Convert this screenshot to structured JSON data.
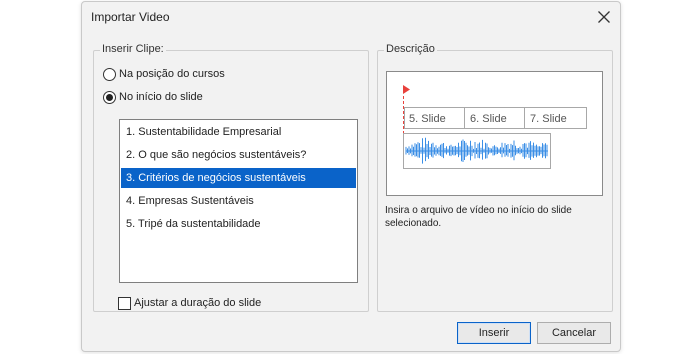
{
  "dialog": {
    "title": "Importar Video",
    "close_icon": "close-icon"
  },
  "insert_clip": {
    "legend": "Inserir Clipe:",
    "options": [
      {
        "label": "Na posição do cursos",
        "checked": false
      },
      {
        "label": "No início do slide",
        "checked": true
      }
    ],
    "slides": [
      {
        "label": "1. Sustentabilidade Empresarial",
        "selected": false
      },
      {
        "label": "2. O que são negócios sustentáveis?",
        "selected": false
      },
      {
        "label": "3. Critérios de negócios sustentáveis",
        "selected": true
      },
      {
        "label": "4. Empresas Sustentáveis",
        "selected": false
      },
      {
        "label": "5. Tripé da sustentabilidade",
        "selected": false
      }
    ],
    "adjust_duration": {
      "label": "Ajustar a duração do slide",
      "checked": false
    }
  },
  "description": {
    "legend": "Descrição",
    "preview_slides": [
      "5. Slide",
      "6. Slide",
      "7. Slide"
    ],
    "text": "Insira o arquivo de vídeo no início do slide selecionado."
  },
  "buttons": {
    "insert": "Inserir",
    "cancel": "Cancelar"
  },
  "colors": {
    "selection": "#0a63c9",
    "marker": "#e8413c",
    "waveform": "#3a8ee6"
  }
}
